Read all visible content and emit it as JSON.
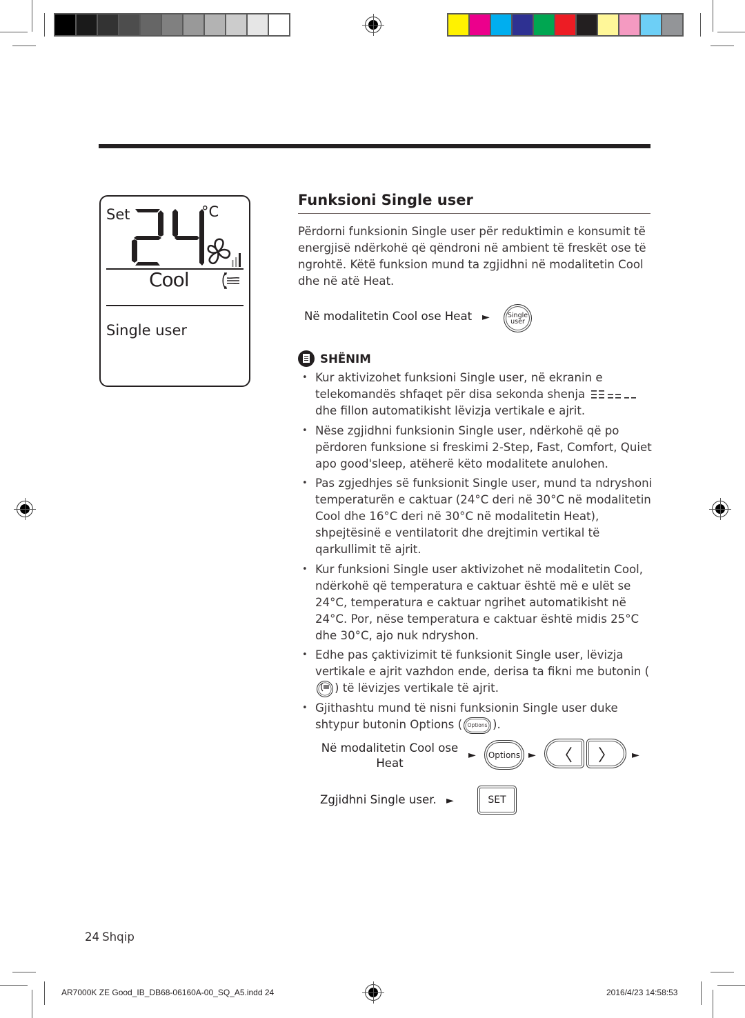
{
  "print_marks": {
    "gray_swatches": [
      "#000000",
      "#1a1a1a",
      "#333333",
      "#4d4d4d",
      "#666666",
      "#808080",
      "#999999",
      "#b3b3b3",
      "#cccccc",
      "#e6e6e6",
      "#ffffff"
    ],
    "color_swatches": [
      "#fff200",
      "#ec008c",
      "#00aeef",
      "#2e3192",
      "#00a651",
      "#ed1c24",
      "#231f20",
      "#fff799",
      "#f49ac1",
      "#6dcff6",
      "#939598"
    ]
  },
  "lcd": {
    "set_label": "Set",
    "temperature": "24",
    "unit": "°C",
    "fan_level": 3,
    "mode": "Cool",
    "function": "Single user"
  },
  "section": {
    "title": "Funksioni Single user",
    "intro": "Përdorni funksionin Single user për reduktimin e konsumit të energjisë ndërkohë që qëndroni në ambient të freskët ose të ngrohtë. Këtë funksion mund ta zgjidhni në modalitetin Cool dhe në atë Heat.",
    "step1_text": "Në modalitetin Cool ose Heat",
    "single_user_button": [
      "Single",
      "user"
    ],
    "arrow": "►"
  },
  "note": {
    "label": "SHËNIM",
    "items": [
      {
        "before": "Kur aktivizohet funksioni Single user, në ekranin e telekomandës shfaqet për disa sekonda shenja",
        "after": " dhe fillon automatikisht lëvizja vertikale e ajrit."
      },
      {
        "text": "Nëse zgjidhni funksionin Single user, ndërkohë që po përdoren funksione si freskimi 2-Step, Fast, Comfort, Quiet apo good'sleep, atëherë këto modalitete anulohen."
      },
      {
        "text": "Pas zgjedhjes së funksionit Single user, mund ta ndryshoni temperaturën e caktuar (24°C deri në 30°C në modalitetin Cool dhe 16°C deri në 30°C në modalitetin Heat), shpejtësinë e ventilatorit dhe drejtimin vertikal të qarkullimit të ajrit."
      },
      {
        "text": "Kur funksioni Single user aktivizohet në modalitetin Cool, ndërkohë që temperatura e caktuar është më e ulët se 24°C, temperatura e caktuar ngrihet automatikisht në 24°C. Por, nëse temperatura e caktuar është midis 25°C dhe 30°C, ajo nuk ndryshon."
      },
      {
        "before": "Edhe pas çaktivizimit të funksionit Single user, lëvizja vertikale e ajrit vazhdon ende, derisa ta fikni me butonin (",
        "after": ") të lëvizjes vertikale të ajrit."
      },
      {
        "before": "Gjithashtu mund të nisni funksionin Single user duke shtypur butonin Options (",
        "after": ").",
        "button": "Options"
      }
    ]
  },
  "steps": {
    "step2_text": "Në modalitetin Cool ose Heat",
    "options_label": "Options",
    "left_label": "〈",
    "right_label": "〉",
    "step3_text": "Zgjidhni Single user.",
    "set_label": "SET"
  },
  "footer": {
    "page_number": "24",
    "language": "Shqip",
    "slug_file": "AR7000K ZE Good_IB_DB68-06160A-00_SQ_A5.indd   24",
    "slug_date": "2016/4/23   14:58:53"
  }
}
